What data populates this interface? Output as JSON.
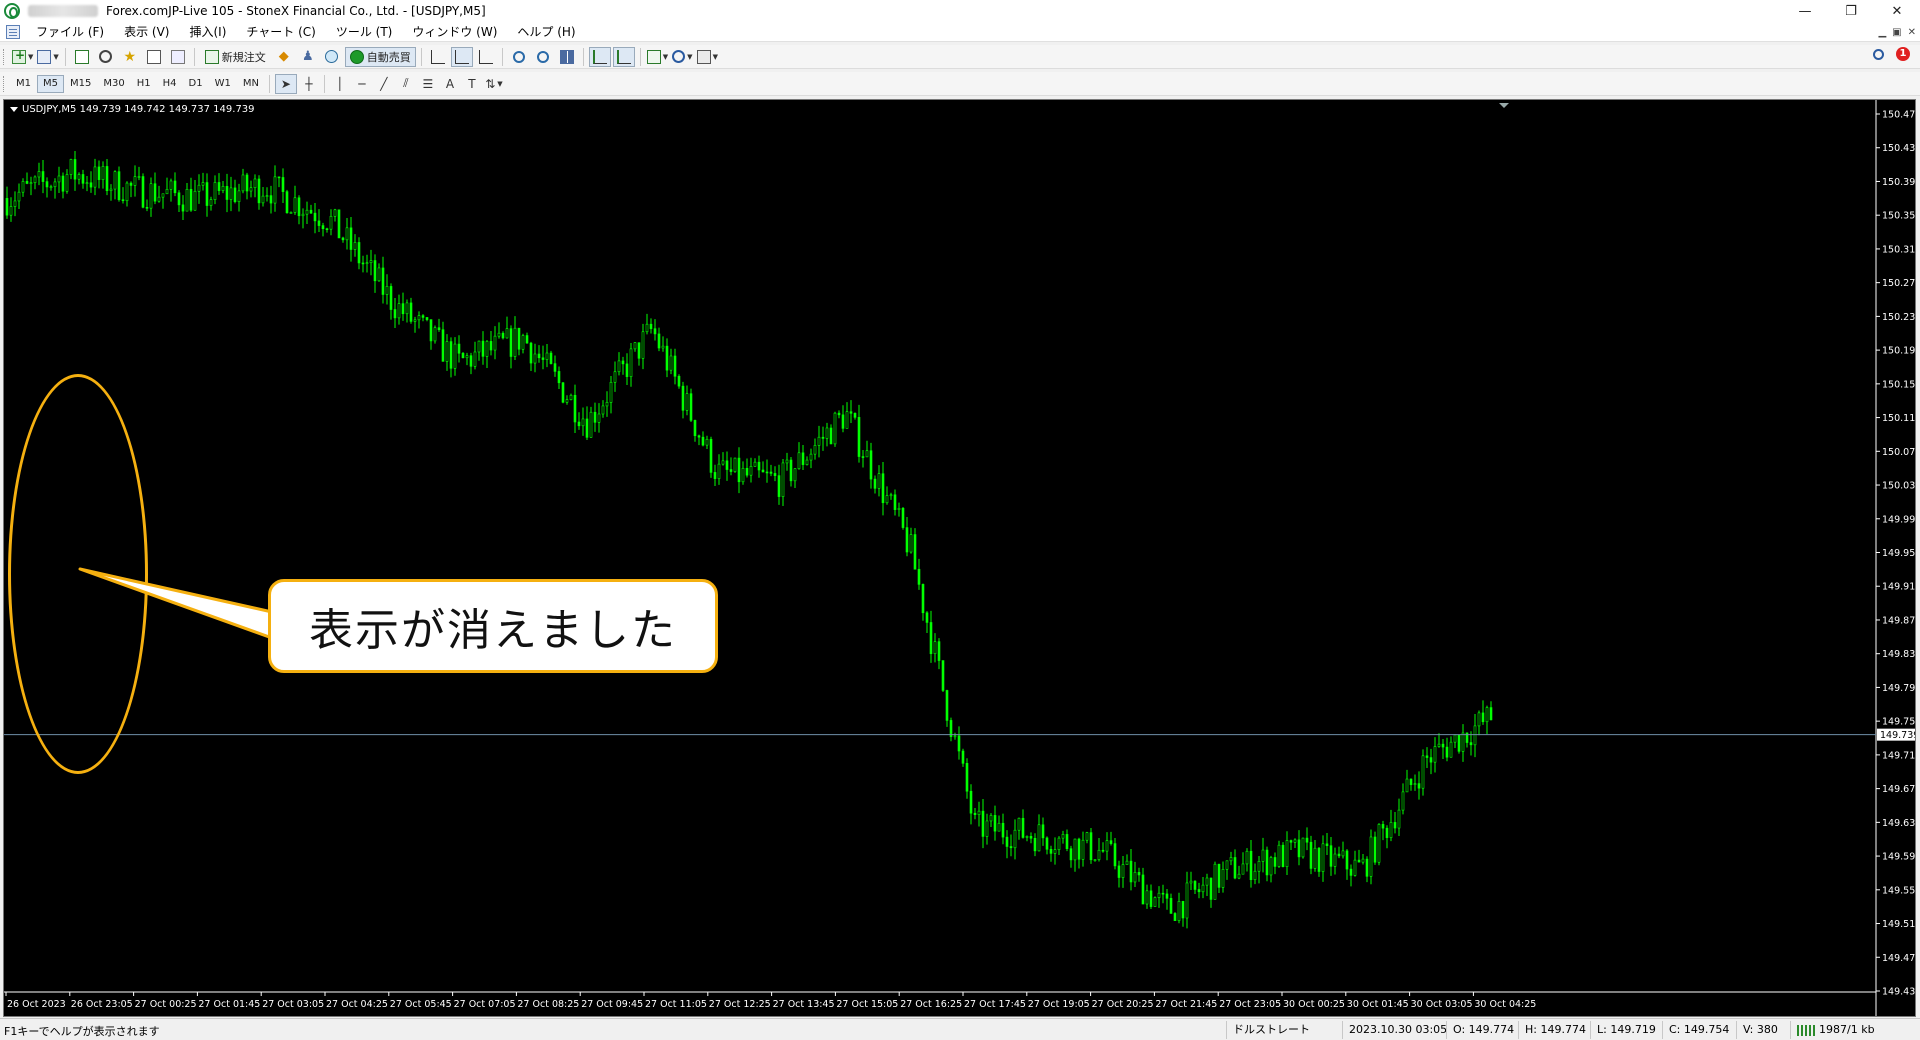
{
  "window": {
    "title": "Forex.comJP-Live 105 - StoneX Financial Co., Ltd. - [USDJPY,M5]",
    "minimize": "—",
    "restore": "❐",
    "close": "✕"
  },
  "menu": {
    "items": [
      "ファイル (F)",
      "表示 (V)",
      "挿入(I)",
      "チャート (C)",
      "ツール (T)",
      "ウィンドウ (W)",
      "ヘルプ (H)"
    ]
  },
  "toolbar": {
    "new_order_label": "新規注文",
    "auto_trade_label": "自動売買",
    "notification_count": "1"
  },
  "timeframes": [
    "M1",
    "M5",
    "M15",
    "M30",
    "H1",
    "H4",
    "D1",
    "W1",
    "MN"
  ],
  "active_timeframe": "M5",
  "tools": {
    "text_tool": "A",
    "label_tool": "T"
  },
  "chart": {
    "header": "USDJPY,M5  149.739 149.742 149.737 149.739",
    "current_price": "149.739",
    "candle_color": "#00ff00",
    "background": "#000000",
    "price_line_color": "#6f8fa8",
    "y_ticks": [
      "150.475",
      "150.435",
      "150.395",
      "150.355",
      "150.315",
      "150.275",
      "150.235",
      "150.195",
      "150.155",
      "150.115",
      "150.075",
      "150.035",
      "149.995",
      "149.955",
      "149.915",
      "149.875",
      "149.835",
      "149.795",
      "149.755",
      "149.715",
      "149.675",
      "149.635",
      "149.595",
      "149.555",
      "149.515",
      "149.475",
      "149.435"
    ],
    "x_ticks": [
      "26 Oct 2023",
      "26 Oct 23:05",
      "27 Oct 00:25",
      "27 Oct 01:45",
      "27 Oct 03:05",
      "27 Oct 04:25",
      "27 Oct 05:45",
      "27 Oct 07:05",
      "27 Oct 08:25",
      "27 Oct 09:45",
      "27 Oct 11:05",
      "27 Oct 12:25",
      "27 Oct 13:45",
      "27 Oct 15:05",
      "27 Oct 16:25",
      "27 Oct 17:45",
      "27 Oct 19:05",
      "27 Oct 20:25",
      "27 Oct 21:45",
      "27 Oct 23:05",
      "30 Oct 00:25",
      "30 Oct 01:45",
      "30 Oct 03:05",
      "30 Oct 04:25"
    ]
  },
  "chart_data": {
    "type": "line",
    "title": "",
    "symbol": "USDJPY",
    "timeframe": "M5",
    "ylim": [
      149.435,
      150.475
    ],
    "x": [
      "26 Oct 2023",
      "26 Oct 23:05",
      "27 Oct 00:25",
      "27 Oct 01:45",
      "27 Oct 03:05",
      "27 Oct 04:25",
      "27 Oct 05:45",
      "27 Oct 07:05",
      "27 Oct 08:25",
      "27 Oct 09:45",
      "27 Oct 11:05",
      "27 Oct 12:25",
      "27 Oct 13:45",
      "27 Oct 15:05",
      "27 Oct 16:25",
      "27 Oct 17:45",
      "27 Oct 19:05",
      "27 Oct 20:25",
      "27 Oct 21:45",
      "27 Oct 23:05",
      "30 Oct 00:25",
      "30 Oct 01:45",
      "30 Oct 03:05",
      "30 Oct 04:25"
    ],
    "series": [
      {
        "values": [
          150.375,
          150.405,
          150.385,
          150.375,
          150.39,
          150.35,
          150.25,
          150.18,
          150.21,
          150.11,
          150.22,
          150.05,
          150.04,
          150.12,
          149.96,
          149.63,
          149.62,
          149.6,
          149.53,
          149.58,
          149.6,
          149.58,
          149.71,
          149.76
        ]
      }
    ]
  },
  "annotation": {
    "callout_text": "表示が消えました"
  },
  "status": {
    "help": "F1キーでヘルプが表示されます",
    "profile": "ドルストレート",
    "datetime": "2023.10.30 03:05",
    "open": "O: 149.774",
    "high": "H: 149.774",
    "low": "L: 149.719",
    "close": "C: 149.754",
    "volume": "V: 380",
    "traffic": "1987/1 kb"
  }
}
